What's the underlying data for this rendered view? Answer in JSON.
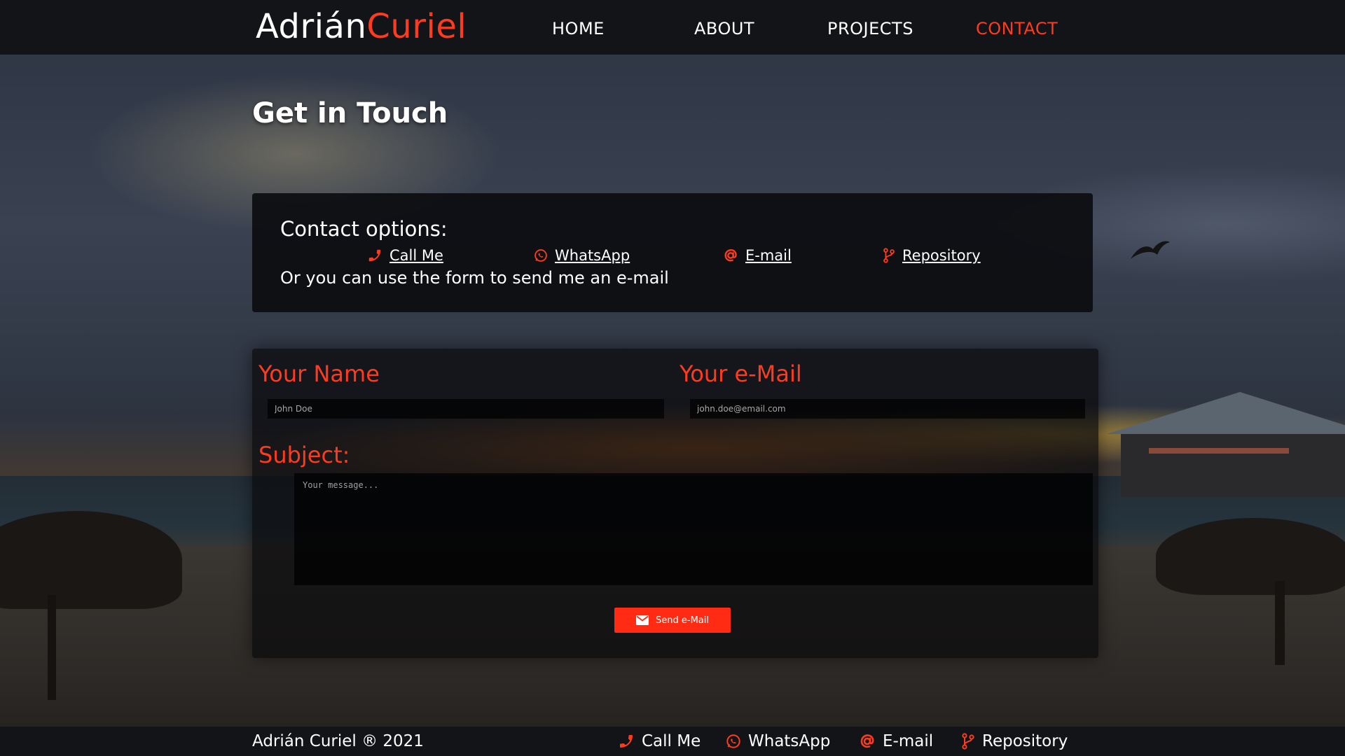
{
  "brand": {
    "first": "Adrián",
    "last": "Curiel"
  },
  "nav": {
    "items": [
      {
        "label": "HOME"
      },
      {
        "label": "ABOUT"
      },
      {
        "label": "PROJECTS"
      },
      {
        "label": "CONTACT",
        "active": true
      }
    ]
  },
  "page": {
    "title": "Get in Touch"
  },
  "contact_options": {
    "heading": "Contact options:",
    "items": [
      {
        "label": "Call Me",
        "icon": "phone-icon"
      },
      {
        "label": "WhatsApp",
        "icon": "whatsapp-icon"
      },
      {
        "label": "E-mail",
        "icon": "at-sign-icon"
      },
      {
        "label": "Repository",
        "icon": "git-branch-icon"
      }
    ],
    "note": "Or you can use the form to send me an e-mail"
  },
  "form": {
    "name_label": "Your Name",
    "name_placeholder": "John Doe",
    "email_label": "Your e-Mail",
    "email_placeholder": "john.doe@email.com",
    "subject_label": "Subject:",
    "message_placeholder": "Your message...",
    "send_label": "Send e-Mail",
    "send_icon": "envelope-icon"
  },
  "footer": {
    "copyright": "Adrián Curiel  ® 2021",
    "links": [
      {
        "label": "Call Me",
        "icon": "phone-icon"
      },
      {
        "label": "WhatsApp",
        "icon": "whatsapp-icon"
      },
      {
        "label": "E-mail",
        "icon": "at-sign-icon"
      },
      {
        "label": "Repository",
        "icon": "git-branch-icon"
      }
    ]
  },
  "colors": {
    "accent": "#ff3b1f",
    "button": "#ff2b13",
    "bar": "#121418",
    "text": "#ffffff"
  }
}
